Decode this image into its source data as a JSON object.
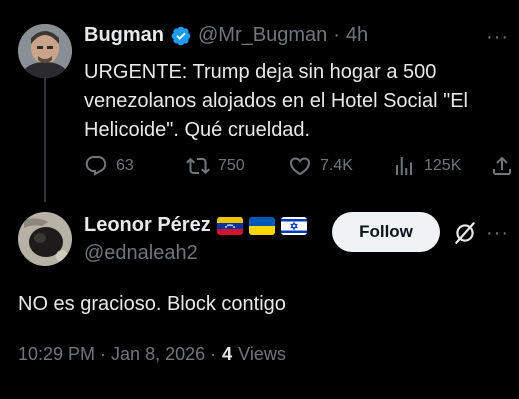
{
  "parent_tweet": {
    "display_name": "Bugman",
    "handle": "@Mr_Bugman",
    "separator": "·",
    "time_ago": "4h",
    "text": "URGENTE: Trump deja sin hogar a 500 venezolanos alojados en el Hotel Social \"El Helicoide\". Qué crueldad.",
    "stats": {
      "replies": "63",
      "reposts": "750",
      "likes": "7.4K",
      "views": "125K"
    }
  },
  "reply_tweet": {
    "display_name": "Leonor Pérez",
    "handle": "@ednaleah2",
    "flags": [
      "venezuela-flag",
      "ukraine-flag",
      "israel-flag"
    ],
    "follow_label": "Follow",
    "text": "NO es gracioso. Block contigo",
    "timestamp": "10:29 PM · Jan 8, 2026 ·",
    "views_count": "4",
    "views_label": "Views"
  },
  "colors": {
    "background": "#000000",
    "text": "#e7e9ea",
    "secondary": "#71767b",
    "verified": "#1d9bf0",
    "button_bg": "#eff3f4"
  }
}
